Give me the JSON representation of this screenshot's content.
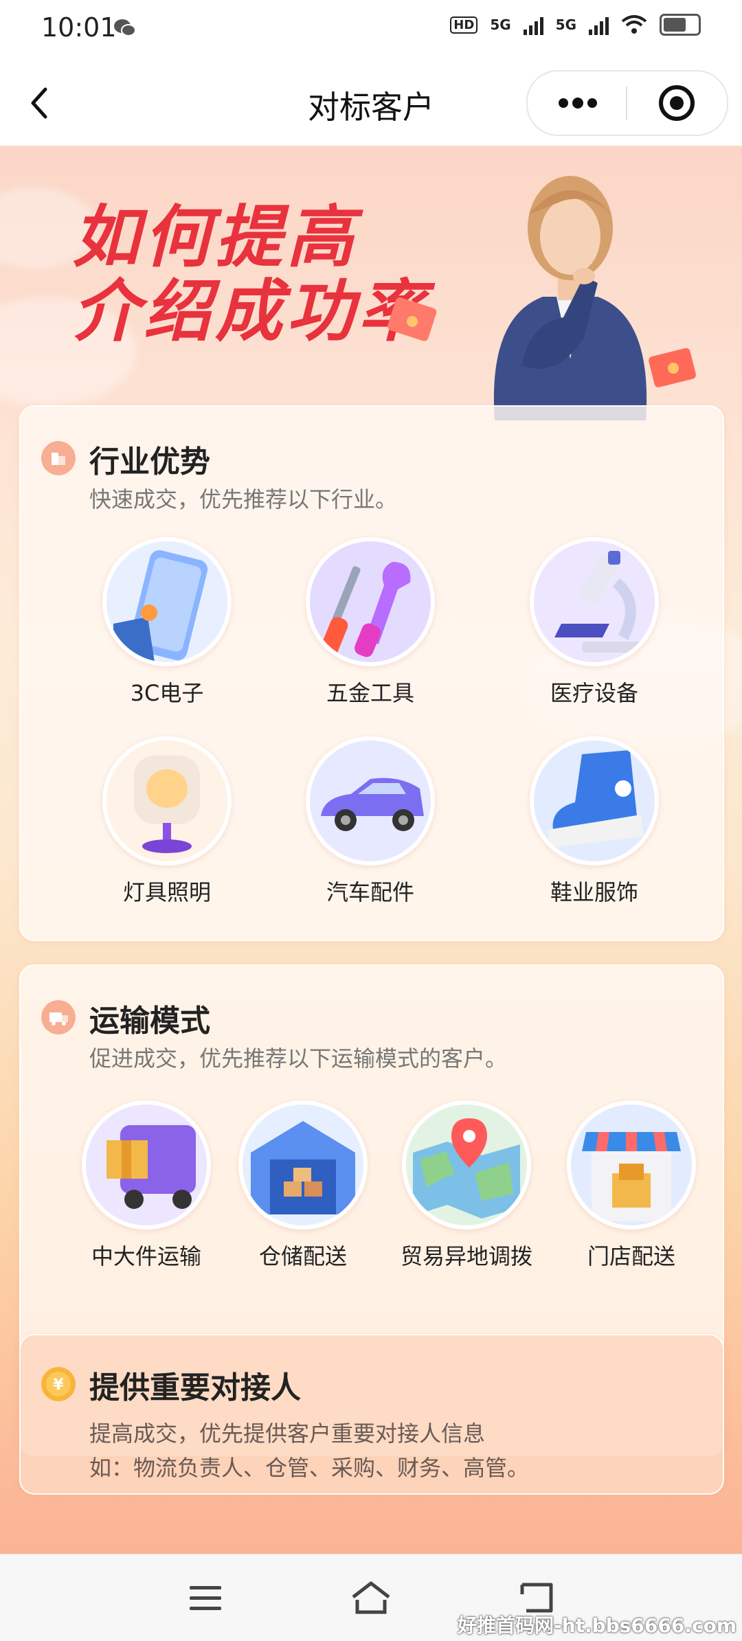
{
  "status_bar": {
    "time": "10:01",
    "network_1": "5G",
    "network_2": "5G",
    "hd": "HD"
  },
  "nav": {
    "title": "对标客户"
  },
  "banner": {
    "line1": "如何提高",
    "line2": "介绍成功率"
  },
  "industry": {
    "title": "行业优势",
    "subtitle": "快速成交，优先推荐以下行业。",
    "items": [
      {
        "label": "3C电子",
        "icon": "smartphone-icon",
        "color": "#8ab4ff"
      },
      {
        "label": "五金工具",
        "icon": "tools-icon",
        "color": "#c9b3ff"
      },
      {
        "label": "医疗设备",
        "icon": "microscope-icon",
        "color": "#ddd0ff"
      },
      {
        "label": "灯具照明",
        "icon": "lamp-icon",
        "color": "#ffe6c8"
      },
      {
        "label": "汽车配件",
        "icon": "car-icon",
        "color": "#cbd2ff"
      },
      {
        "label": "鞋业服饰",
        "icon": "sneaker-icon",
        "color": "#d6e2ff"
      }
    ]
  },
  "transport": {
    "title": "运输模式",
    "subtitle": "促进成交，优先推荐以下运输模式的客户。",
    "items": [
      {
        "label": "中大件运输",
        "icon": "truck-icon",
        "color": "#cfc4ff"
      },
      {
        "label": "仓储配送",
        "icon": "warehouse-icon",
        "color": "#c8dcff"
      },
      {
        "label": "贸易异地调拨",
        "icon": "map-pin-icon",
        "color": "#d6f0d8"
      },
      {
        "label": "门店配送",
        "icon": "store-icon",
        "color": "#d8e6ff"
      }
    ]
  },
  "contact": {
    "title": "提供重要对接人",
    "line1": "提高成交，优先提供客户重要对接人信息",
    "line2": "如：物流负责人、仓管、采购、财务、高管。"
  },
  "watermark": "好推首码网-ht.bbs6666.com",
  "colors": {
    "accent_red": "#e8323d",
    "card_icon": "#f4a58a"
  }
}
